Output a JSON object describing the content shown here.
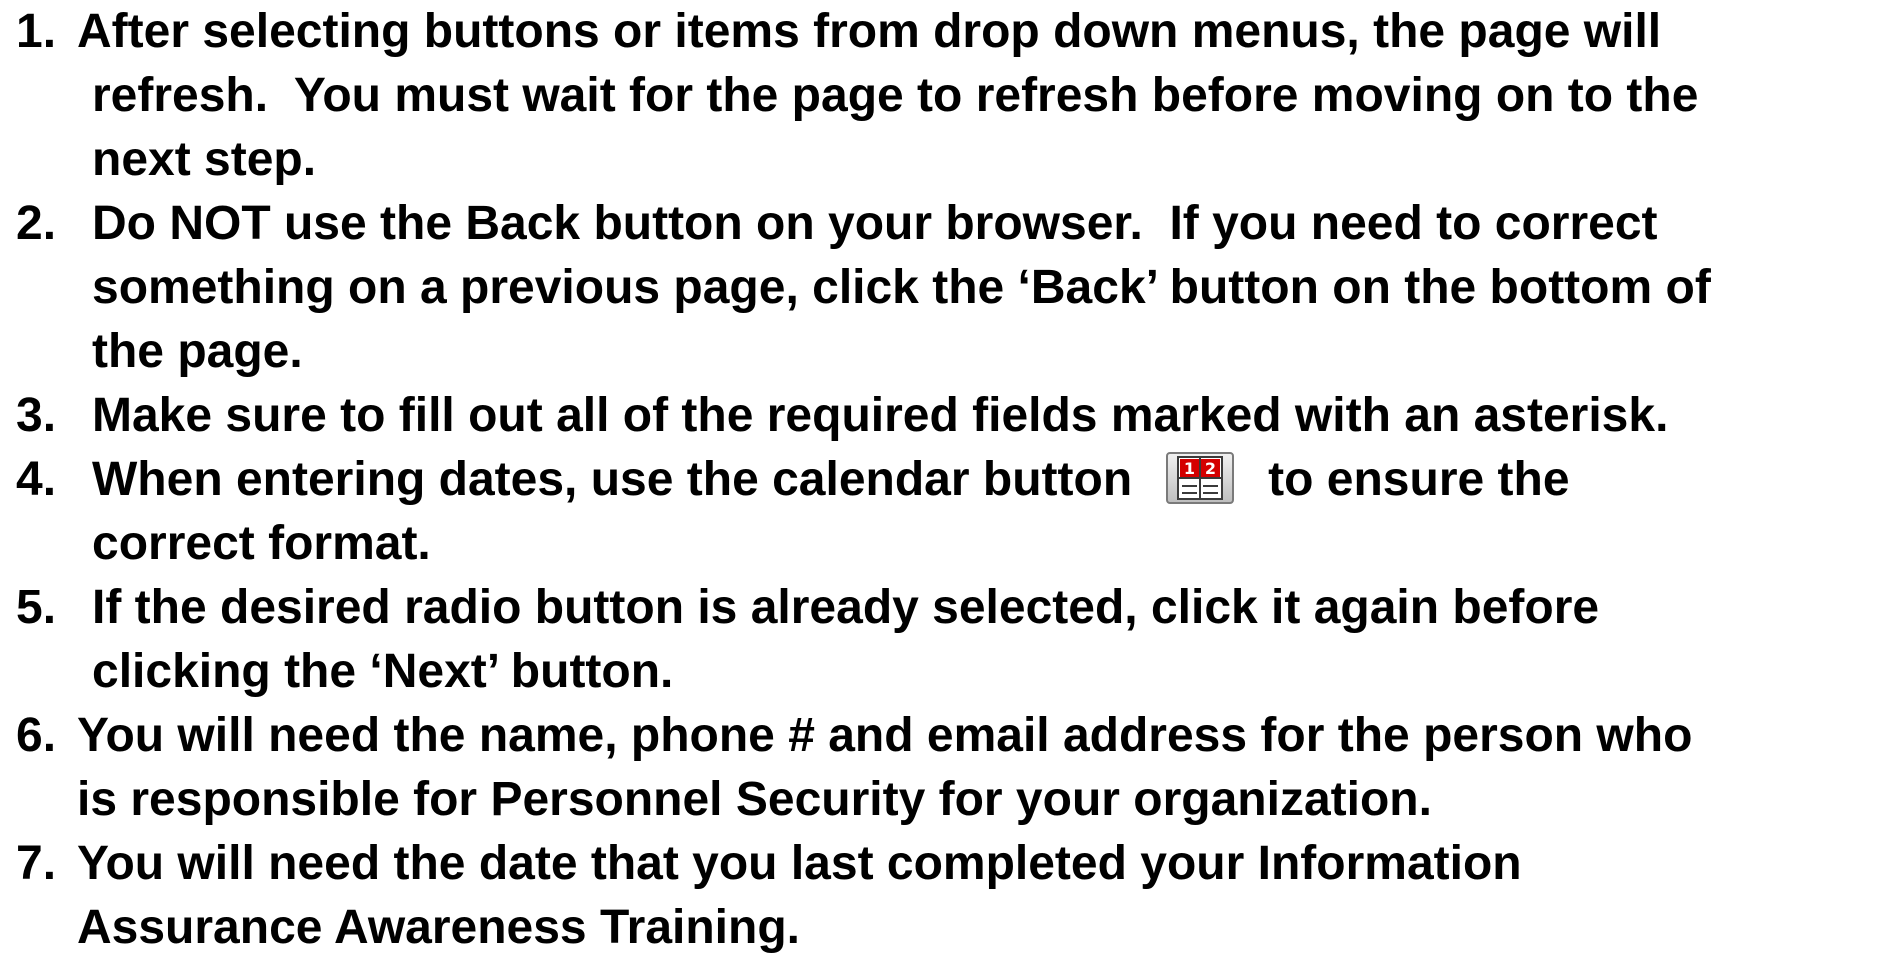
{
  "instructions": [
    {
      "number": "1.",
      "lines": [
        "After selecting buttons or items from drop down menus, the page will",
        "refresh.  You must wait for the page to refresh before moving on to the",
        "next step."
      ]
    },
    {
      "number": "2.",
      "lines": [
        "Do NOT use the Back button on your browser.  If you need to correct",
        "something on a previous page, click the ‘Back’ button on the bottom of",
        "the page."
      ]
    },
    {
      "number": "3.",
      "lines": [
        "Make sure to fill out all of the required fields marked with an asterisk."
      ]
    },
    {
      "number": "4.",
      "line1_before_icon": "When entering dates, use the calendar button",
      "line1_after_icon": "to ensure the",
      "lines_rest": [
        "correct format."
      ],
      "icon": "calendar-icon"
    },
    {
      "number": "5.",
      "lines": [
        "If the desired radio button is already selected, click it again before",
        "clicking the ‘Next’ button."
      ]
    },
    {
      "number": "6.",
      "lines": [
        "You will need the name, phone # and email address for the person who",
        "is responsible for Personnel Security for your organization."
      ]
    },
    {
      "number": "7.",
      "lines": [
        "You will need the date that you last completed your Information",
        "Assurance Awareness Training."
      ]
    }
  ],
  "colors": {
    "text": "#000000",
    "background": "#ffffff",
    "icon_red": "#d40000",
    "icon_frame": "#8c8c8c"
  }
}
